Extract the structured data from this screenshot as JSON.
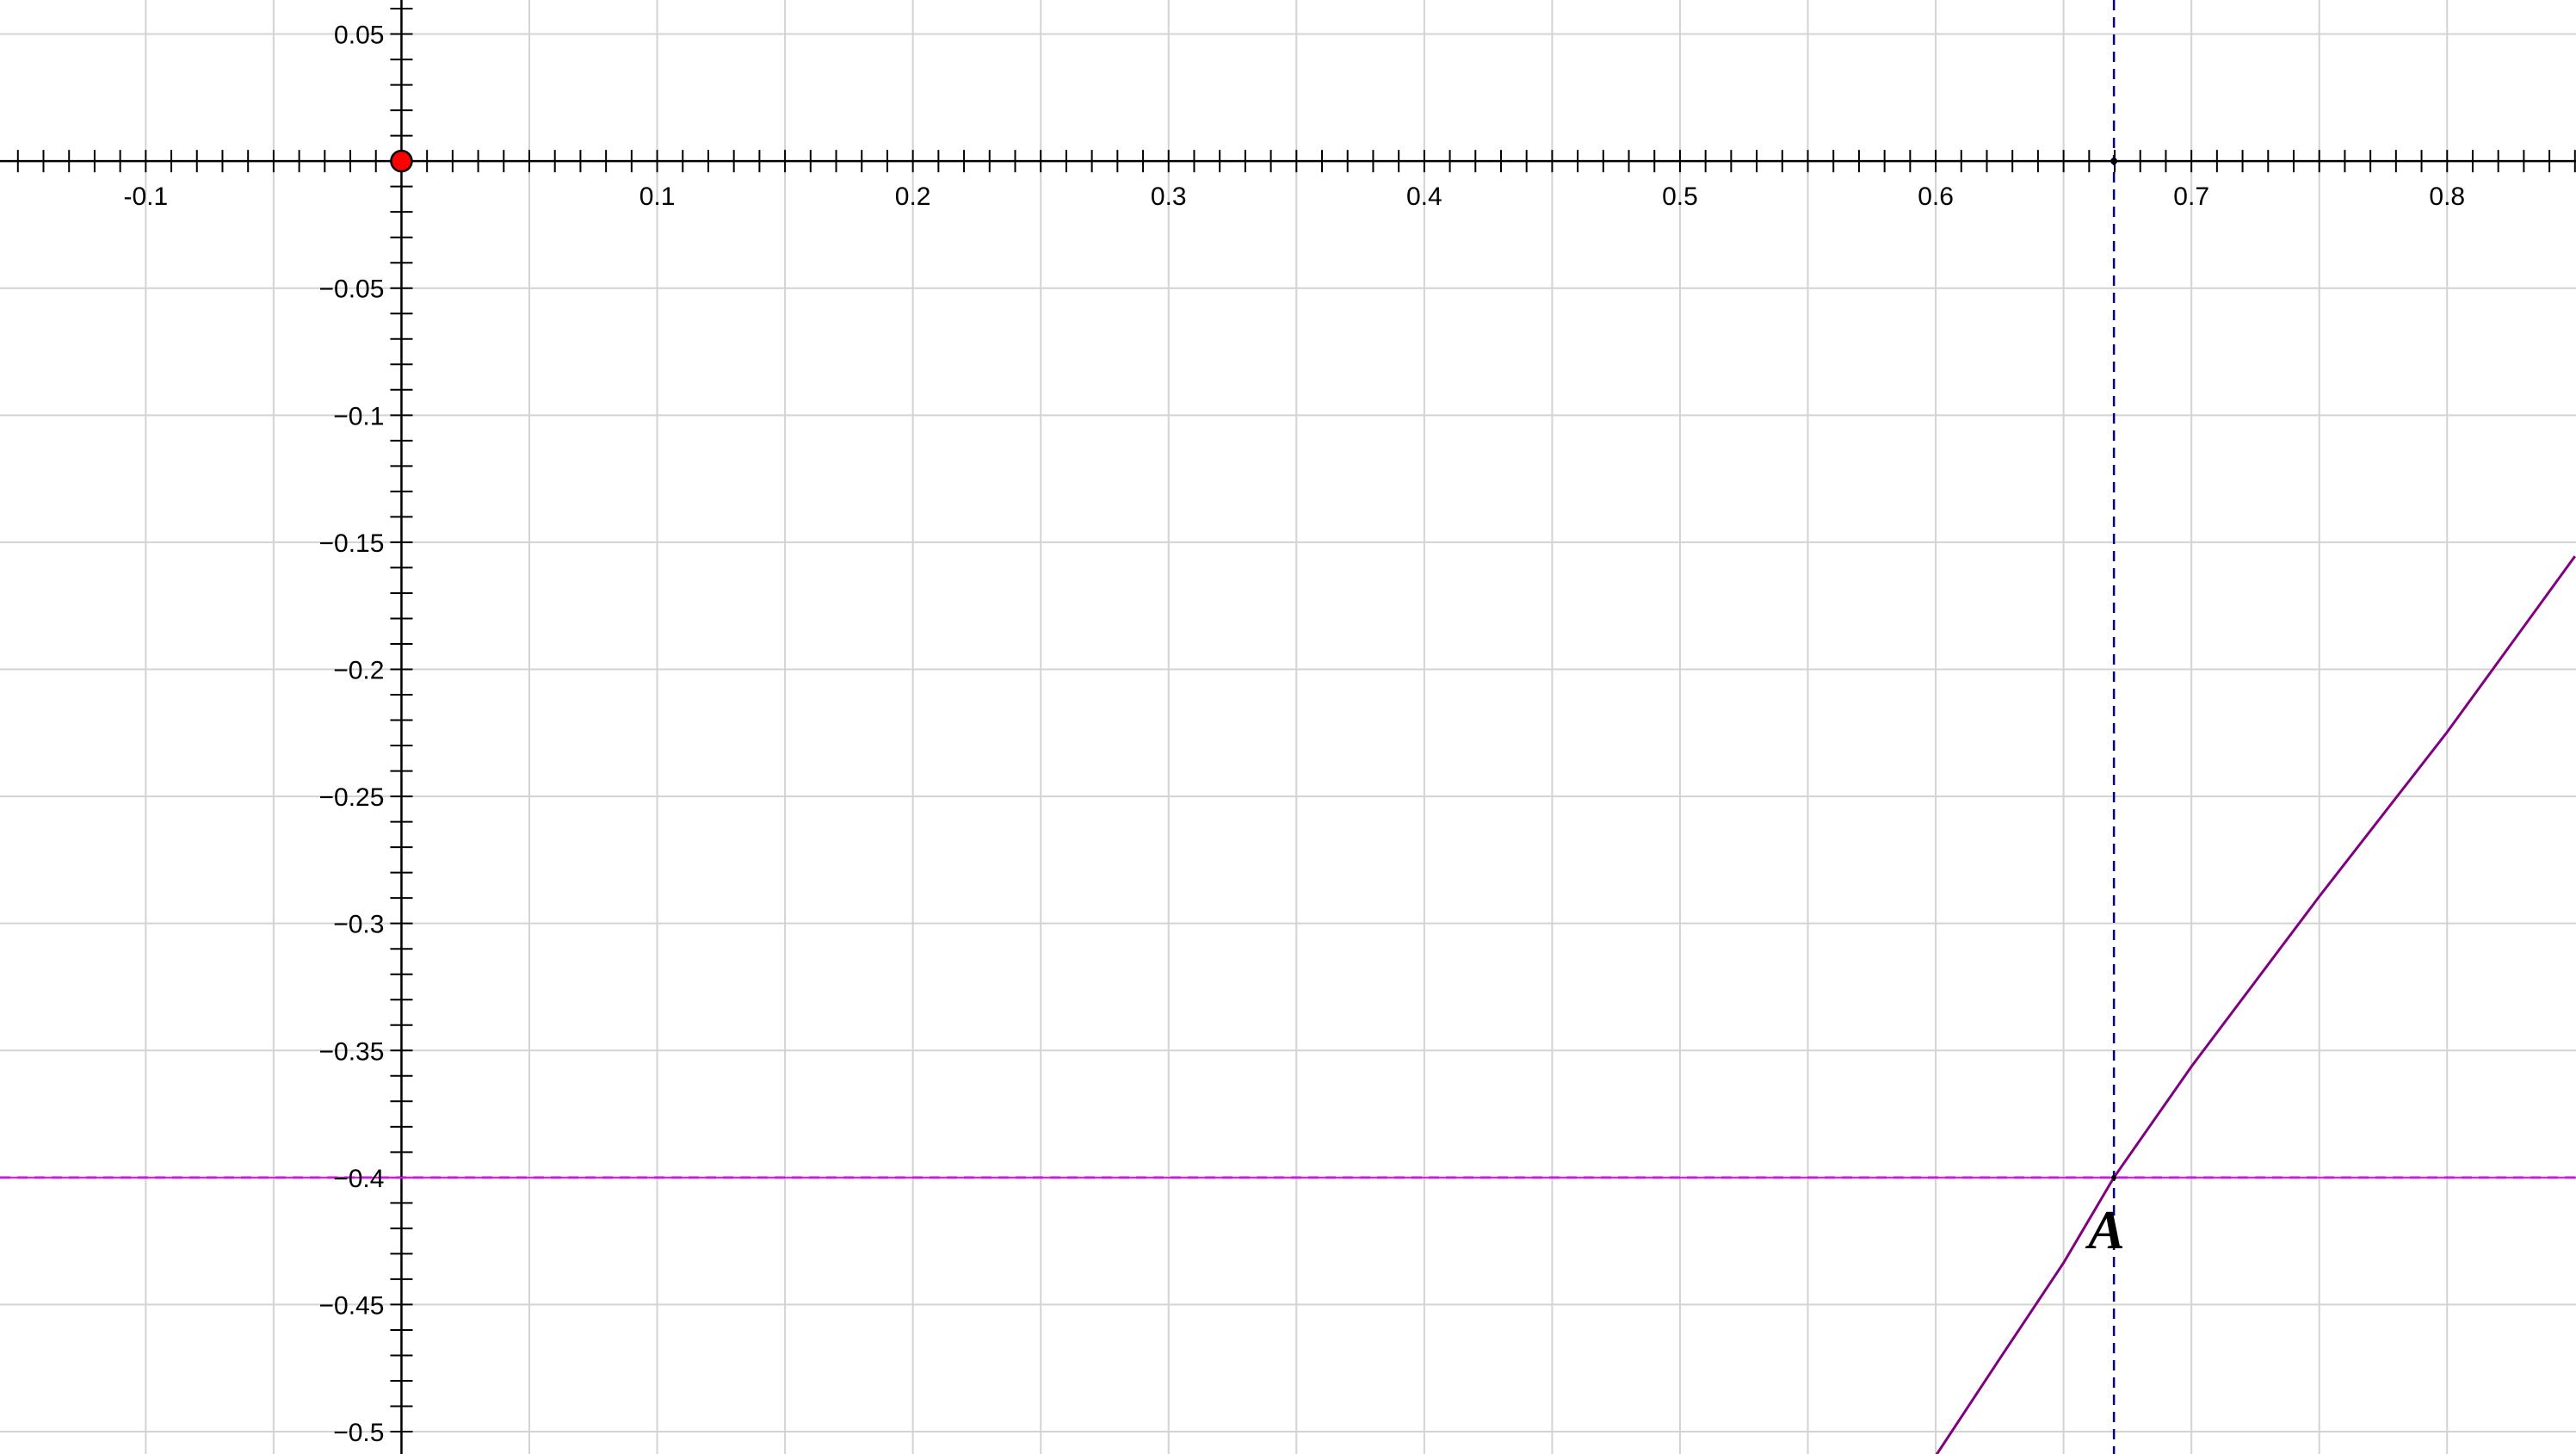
{
  "chart_data": {
    "type": "line",
    "title": "",
    "xlabel": "",
    "ylabel": "",
    "xlim": [
      -0.157,
      0.8504
    ],
    "ylim": [
      -0.5088,
      0.0634
    ],
    "grid": true,
    "x_major_ticks": [
      -0.1,
      0.1,
      0.2,
      0.3,
      0.4,
      0.5,
      0.6,
      0.7,
      0.8
    ],
    "x_tick_labels": [
      "-0.1",
      "0.1",
      "0.2",
      "0.3",
      "0.4",
      "0.5",
      "0.6",
      "0.7",
      "0.8"
    ],
    "y_major_ticks": [
      0.05,
      -0.05,
      -0.1,
      -0.15,
      -0.2,
      -0.25,
      -0.3,
      -0.35,
      -0.4,
      -0.45,
      -0.5
    ],
    "y_tick_labels": [
      "0.05",
      "−0.05",
      "−0.1",
      "−0.15",
      "−0.2",
      "−0.25",
      "−0.3",
      "−0.35",
      "−0.4",
      "−0.45",
      "−0.5"
    ],
    "x_gridlines": [
      -0.1,
      -0.05,
      0,
      0.05,
      0.1,
      0.15,
      0.2,
      0.25,
      0.3,
      0.35,
      0.4,
      0.45,
      0.5,
      0.55,
      0.6,
      0.65,
      0.7,
      0.75,
      0.8
    ],
    "y_gridlines": [
      0.05,
      0,
      -0.05,
      -0.1,
      -0.15,
      -0.2,
      -0.25,
      -0.3,
      -0.35,
      -0.4,
      -0.45,
      -0.5
    ],
    "minor_tick_step": 0.01,
    "series": [
      {
        "color": "#800080",
        "x": [
          0.6,
          0.625,
          0.65,
          0.6697,
          0.7,
          0.75,
          0.8,
          0.85
        ],
        "y": [
          -0.5095,
          -0.4714,
          -0.4336,
          -0.4,
          -0.3563,
          -0.2894,
          -0.2247,
          -0.1555
        ]
      }
    ],
    "reference_lines": [
      {
        "orientation": "horizontal",
        "value": -0.4,
        "style": "dashed",
        "color": "#00008b"
      },
      {
        "orientation": "vertical",
        "value": 0.6697,
        "style": "dashed",
        "color": "#00008b"
      }
    ],
    "horizontal_line": {
      "value": -0.4,
      "color": "#ff00ff"
    },
    "points": [
      {
        "label": "",
        "x": 0,
        "y": 0,
        "color": "#ff0000"
      },
      {
        "label": "",
        "x": 0.6697,
        "y": 0,
        "color": "#000000"
      },
      {
        "label": "A",
        "x": 0.6697,
        "y": -0.4,
        "color": "#000000"
      }
    ]
  }
}
